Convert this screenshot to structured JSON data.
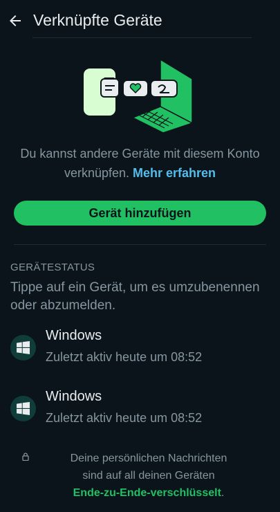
{
  "header": {
    "title": "Verknüpfte Geräte"
  },
  "intro": {
    "text": "Du kannst andere Geräte mit diesem Konto verknüpfen.",
    "link": "Mehr erfahren"
  },
  "add_button": {
    "label": "Gerät hinzufügen"
  },
  "device_status": {
    "label": "GERÄTESTATUS",
    "description": "Tippe auf ein Gerät, um es umzubenennen oder abzumelden."
  },
  "devices": [
    {
      "name": "Windows",
      "status": "Zuletzt aktiv heute um 08:52",
      "icon": "windows-icon"
    },
    {
      "name": "Windows",
      "status": "Zuletzt aktiv heute um 08:52",
      "icon": "windows-icon"
    }
  ],
  "footer": {
    "line1": "Deine persönlichen Nachrichten",
    "line2": "sind auf all deinen Geräten",
    "e2e_link": "Ende-zu-Ende-verschlüsselt",
    "period": "."
  },
  "colors": {
    "background": "#0b141a",
    "accent": "#21c063",
    "link": "#53bdeb",
    "text_primary": "#e9edef",
    "text_secondary": "#8696a0"
  }
}
